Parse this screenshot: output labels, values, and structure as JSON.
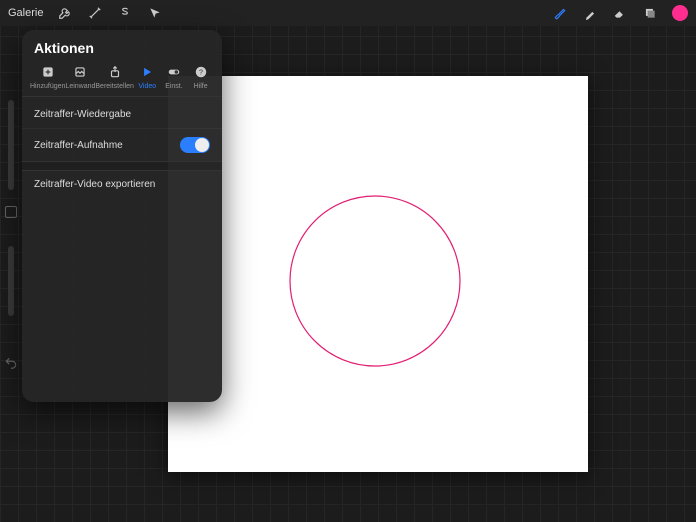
{
  "topbar": {
    "gallery_label": "Galerie"
  },
  "icons": {
    "wrench": "wrench-icon",
    "wand": "wand-icon",
    "s": "s",
    "cursor": "cursor-icon",
    "brush": "brush-icon",
    "smudge": "smudge-icon",
    "eraser": "eraser-icon",
    "layers": "layers-icon"
  },
  "color_swatch": "#ff2d90",
  "popover": {
    "title": "Aktionen",
    "tabs": [
      {
        "label": "Hinzufügen",
        "icon": "add-icon"
      },
      {
        "label": "Leinwand",
        "icon": "canvas-icon"
      },
      {
        "label": "Bereitstellen",
        "icon": "share-icon"
      },
      {
        "label": "Video",
        "icon": "play-icon",
        "active": true
      },
      {
        "label": "Einst.",
        "icon": "settings-toggle-icon"
      },
      {
        "label": "Hilfe",
        "icon": "help-icon"
      }
    ],
    "menu": {
      "replay_label": "Zeitraffer-Wiedergabe",
      "record_label": "Zeitraffer-Aufnahme",
      "record_on": true,
      "export_label": "Zeitraffer-Video exportieren"
    }
  },
  "canvas_shape": {
    "type": "circle",
    "stroke": "#e11d72"
  }
}
